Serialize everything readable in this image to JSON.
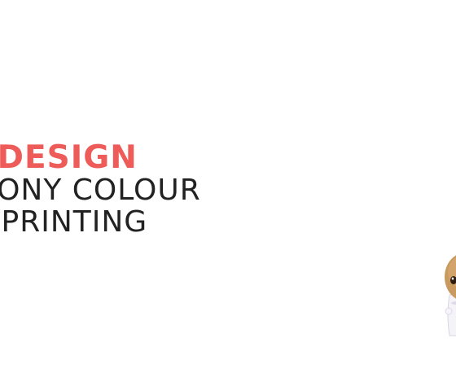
{
  "headline": {
    "line1": "W DESIGN",
    "line2": "RMONY COLOUR",
    "line3": "OF PRINTING"
  },
  "colors": {
    "accent": "#ee5c5a",
    "text": "#222222",
    "background": "#ffffff"
  },
  "mascot": {
    "icon": "paper-doll-icon"
  }
}
